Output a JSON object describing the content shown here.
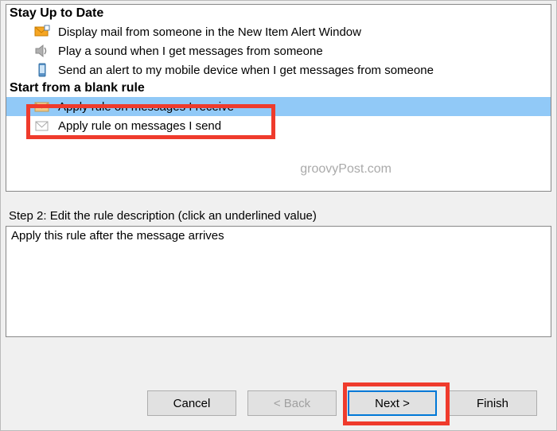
{
  "section1": {
    "header": "Stay Up to Date"
  },
  "section2": {
    "header": "Start from a blank rule"
  },
  "items": {
    "mailAlert": "Display mail from someone in the New Item Alert Window",
    "playSound": "Play a sound when I get messages from someone",
    "mobileAlert": "Send an alert to my mobile device when I get messages from someone",
    "receive": "Apply rule on messages I receive",
    "send": "Apply rule on messages I send"
  },
  "watermark": "groovyPost.com",
  "step2": {
    "label": "Step 2: Edit the rule description (click an underlined value)",
    "text": "Apply this rule after the message arrives"
  },
  "buttons": {
    "cancel": "Cancel",
    "back": "< Back",
    "next": "Next >",
    "finish": "Finish"
  }
}
